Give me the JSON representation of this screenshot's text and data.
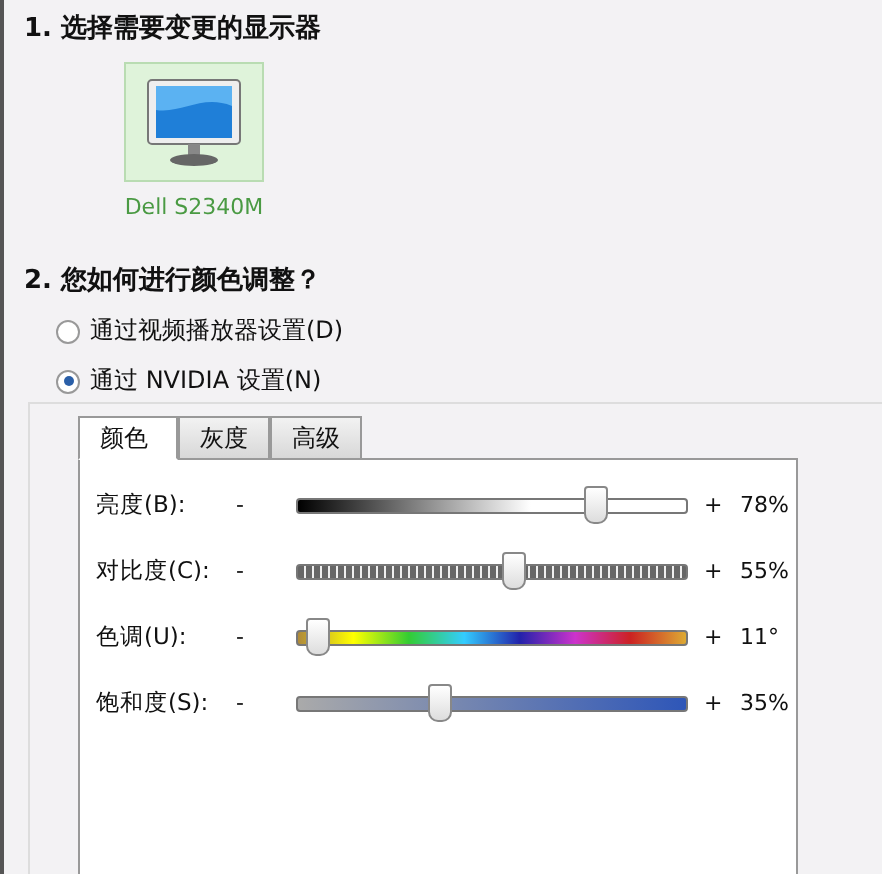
{
  "section_1": {
    "heading": "1. 选择需要变更的显示器",
    "displays": [
      {
        "name": "Dell S2340M",
        "selected": true
      }
    ]
  },
  "section_2": {
    "heading": "2. 您如何进行颜色调整？",
    "options": [
      {
        "label": "通过视频播放器设置(D)",
        "selected": false
      },
      {
        "label": "通过 NVIDIA 设置(N)",
        "selected": true
      }
    ],
    "tabs": [
      {
        "label": "颜色",
        "selected": true
      },
      {
        "label": "灰度",
        "selected": false
      },
      {
        "label": "高级",
        "selected": false
      }
    ],
    "sliders": [
      {
        "kind": "brightness",
        "label": "亮度(B):",
        "minus": "-",
        "plus": "+",
        "level": 0.76,
        "reading": "78%"
      },
      {
        "kind": "contrast",
        "label": "对比度(C):",
        "minus": "-",
        "plus": "+",
        "level": 0.55,
        "reading": "55%"
      },
      {
        "kind": "hue",
        "label": "色调(U):",
        "minus": "-",
        "plus": "+",
        "level": 0.05,
        "reading": "11°"
      },
      {
        "kind": "saturation",
        "label": "饱和度(S):",
        "minus": "-",
        "plus": "+",
        "level": 0.36,
        "reading": "35%"
      }
    ]
  }
}
